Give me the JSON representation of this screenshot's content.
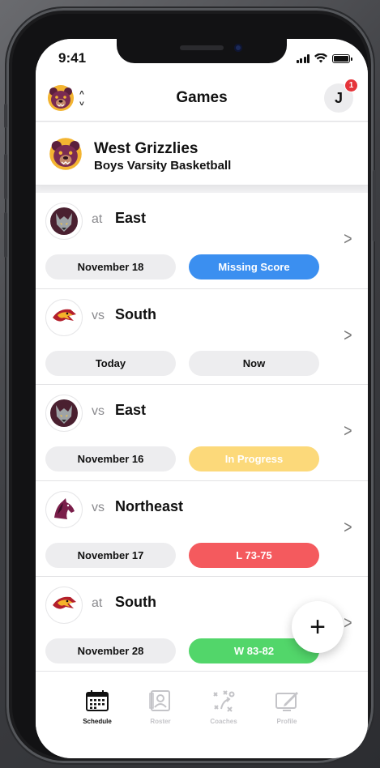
{
  "status_bar": {
    "time": "9:41"
  },
  "header": {
    "title": "Games",
    "avatar_initial": "J",
    "notification_count": "1"
  },
  "team": {
    "name": "West Grizzlies",
    "subtitle": "Boys Varsity Basketball"
  },
  "games": [
    {
      "prep": "at",
      "opponent": "East",
      "date": "November 18",
      "status": "Missing Score",
      "status_bg": "#3b8ff0",
      "status_fg": "#ffffff",
      "logo": "wolf"
    },
    {
      "prep": "vs",
      "opponent": "South",
      "date": "Today",
      "status": "Now",
      "status_bg": "#ededef",
      "status_fg": "#111111",
      "logo": "eagle"
    },
    {
      "prep": "vs",
      "opponent": "East",
      "date": "November 16",
      "status": "In Progress",
      "status_bg": "#fcd97a",
      "status_fg": "#ffffff",
      "logo": "wolf"
    },
    {
      "prep": "vs",
      "opponent": "Northeast",
      "date": "November 17",
      "status": "L 73-75",
      "status_bg": "#f45a5e",
      "status_fg": "#ffffff",
      "logo": "mustang"
    },
    {
      "prep": "at",
      "opponent": "South",
      "date": "November 28",
      "status": "W 83-82",
      "status_bg": "#52d66a",
      "status_fg": "#ffffff",
      "logo": "eagle"
    }
  ],
  "fab": {
    "icon": "plus-icon",
    "glyph": "+"
  },
  "tabbar": {
    "tabs": [
      {
        "label": "Schedule",
        "icon": "calendar-icon",
        "active": true
      },
      {
        "label": "Roster",
        "icon": "roster-icon",
        "active": false
      },
      {
        "label": "Coaches",
        "icon": "playbook-icon",
        "active": false
      },
      {
        "label": "Profile",
        "icon": "profile-edit-icon",
        "active": false
      }
    ]
  }
}
